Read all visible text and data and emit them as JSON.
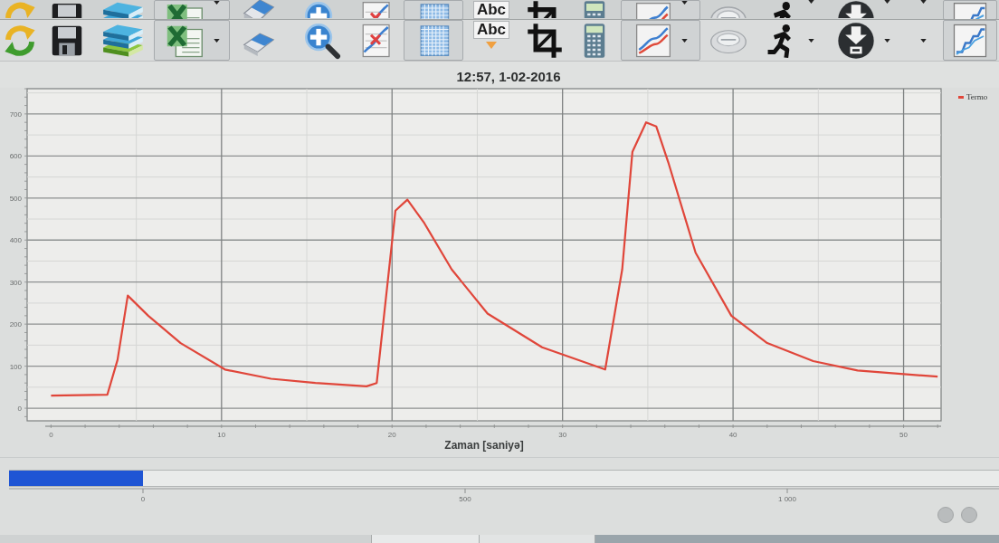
{
  "toolbar_strips": [
    {
      "format_label": "Abc"
    },
    {
      "format_label": "Abc"
    }
  ],
  "chart": {
    "chart_data": {
      "type": "line",
      "title": "12:57, 1-02-2016",
      "xlabel": "Zaman [saniyə]",
      "x": [
        0,
        3.3,
        3.9,
        4.5,
        5.7,
        7.6,
        10.2,
        12.9,
        15.5,
        18.5,
        19.1,
        20.2,
        20.9,
        21.9,
        23.5,
        25.6,
        28.8,
        32.5,
        33.5,
        34.1,
        34.9,
        35.5,
        36.2,
        37.8,
        39.9,
        42,
        44.7,
        47.3,
        52
      ],
      "series": [
        {
          "name": "Termo",
          "color": "#e0463a",
          "values": [
            30,
            32,
            115,
            268,
            220,
            155,
            92,
            70,
            60,
            52,
            60,
            470,
            496,
            440,
            330,
            225,
            145,
            92,
            330,
            610,
            680,
            670,
            585,
            370,
            220,
            155,
            112,
            90,
            75
          ]
        }
      ],
      "xlim": [
        -1.4,
        52.2
      ],
      "ylim": [
        -30,
        760
      ],
      "xticks": [
        0,
        10,
        20,
        30,
        40,
        50
      ],
      "yticks": [
        0,
        100,
        200,
        300,
        400,
        500,
        600,
        700
      ],
      "grid": true
    }
  },
  "progress": {
    "level": 0.135
  },
  "ruler": {
    "labels": [
      "0",
      "500",
      "1 000"
    ]
  }
}
